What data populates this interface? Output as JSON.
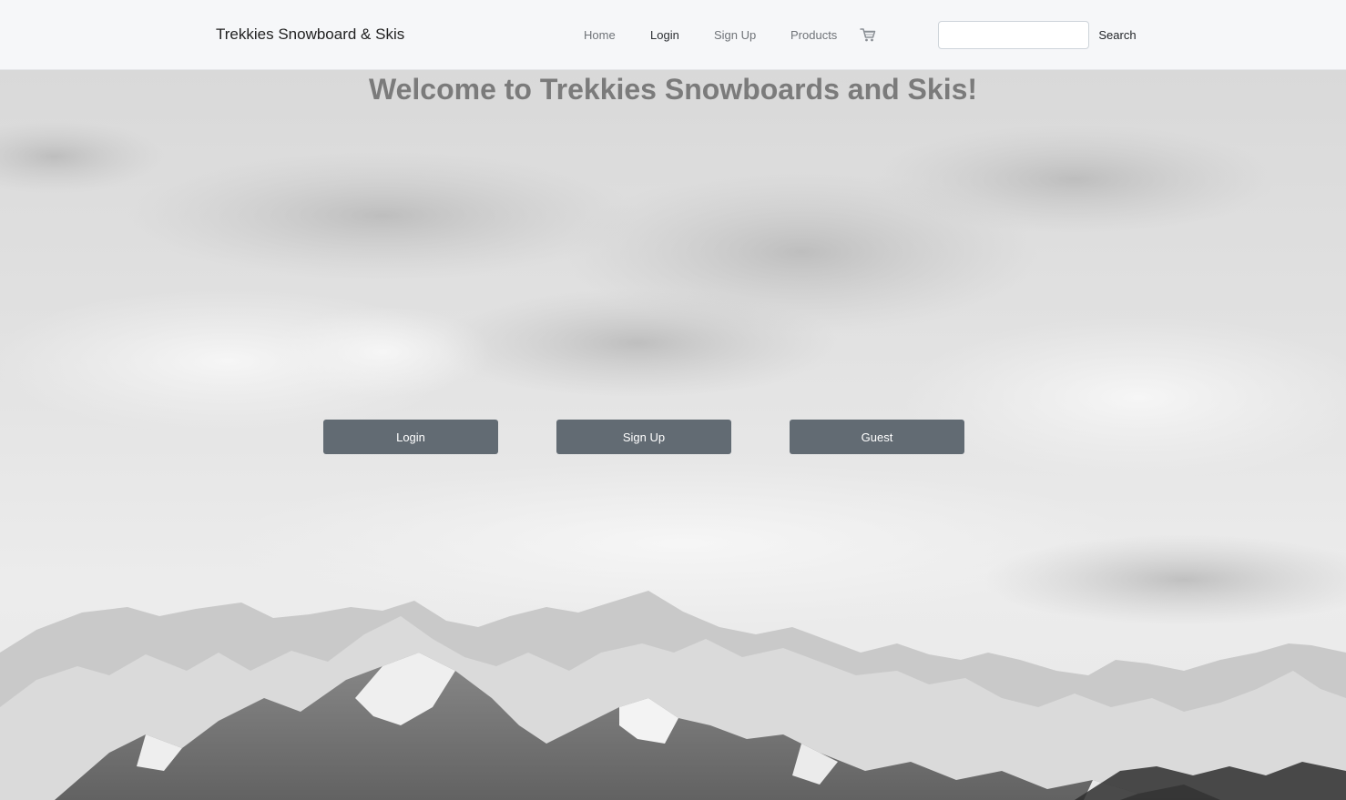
{
  "navbar": {
    "brand": "Trekkies Snowboard & Skis",
    "links": [
      {
        "label": "Home"
      },
      {
        "label": "Login"
      },
      {
        "label": "Sign Up"
      },
      {
        "label": "Products"
      }
    ],
    "cart_icon": "shopping-cart-icon",
    "search": {
      "value": "",
      "placeholder": "",
      "button_label": "Search"
    }
  },
  "hero": {
    "heading": "Welcome to Trekkies Snowboards and Skis!",
    "buttons": [
      {
        "label": "Login"
      },
      {
        "label": "Sign Up"
      },
      {
        "label": "Guest"
      }
    ],
    "background": "cloudy-sky-snowy-mountains-grayscale"
  },
  "colors": {
    "navbar_bg": "#f6f7f9",
    "heading": "#7b7b7b",
    "button_bg": "#626b73",
    "button_text": "#ffffff"
  }
}
